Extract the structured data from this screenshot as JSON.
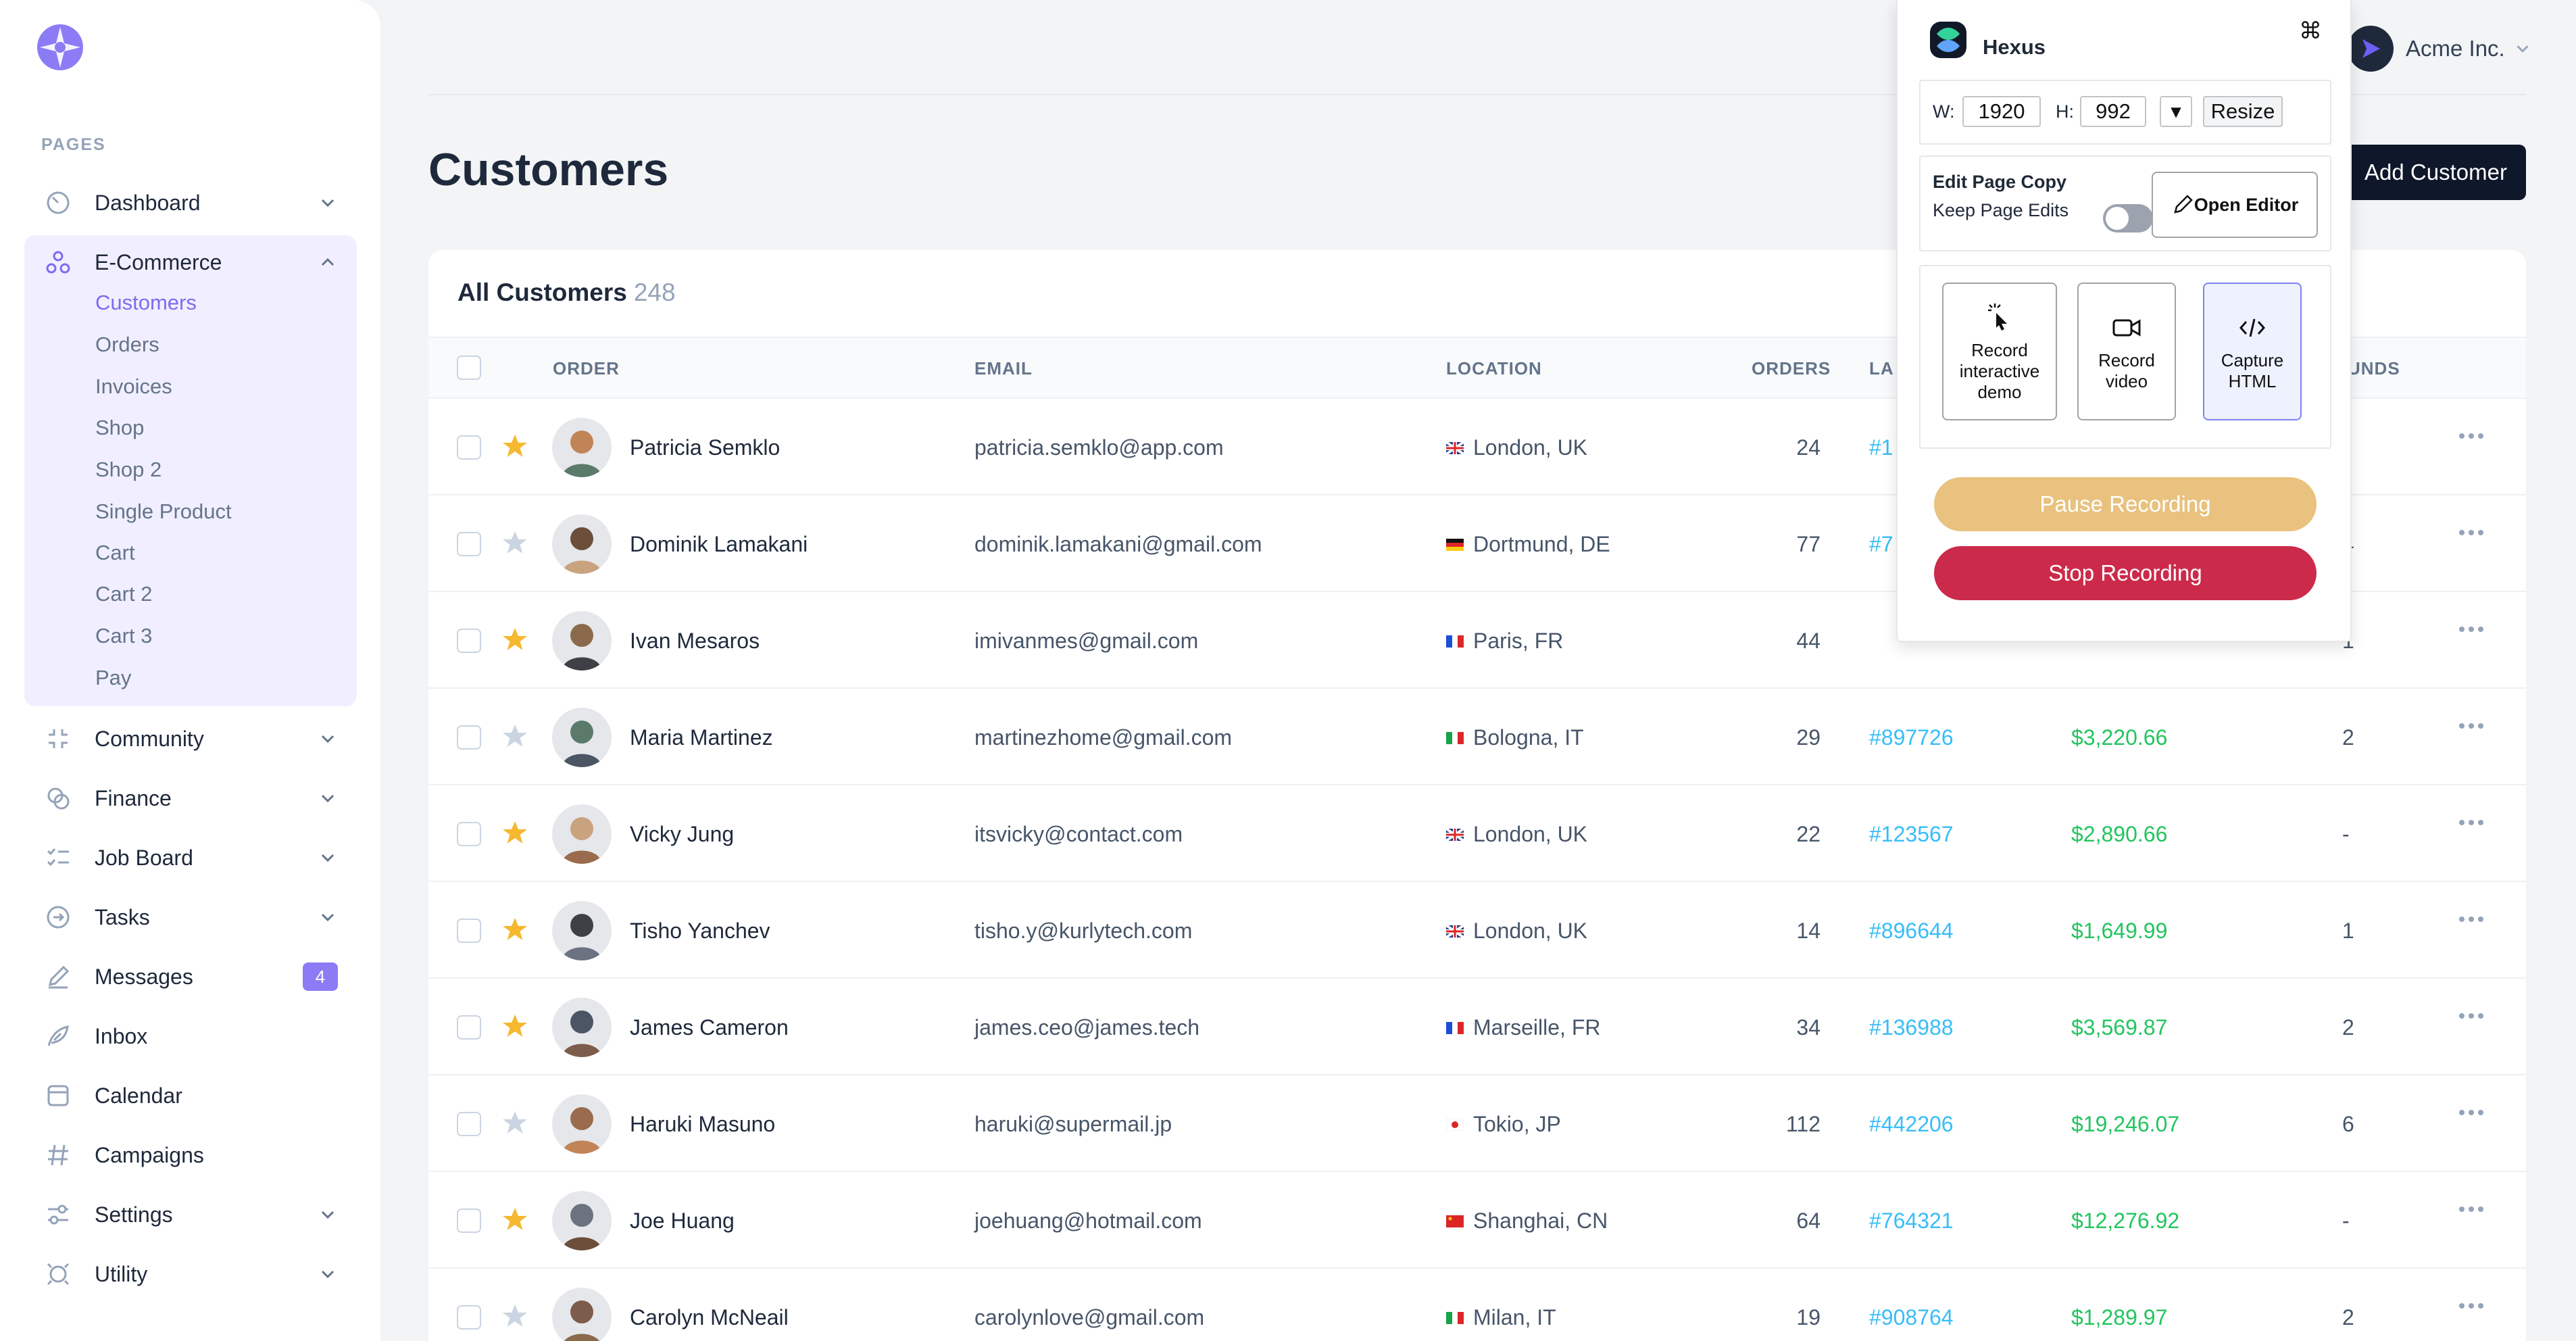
{
  "sidebar": {
    "pages_label": "PAGES",
    "items": [
      {
        "label": "Dashboard"
      },
      {
        "label": "E-Commerce"
      },
      {
        "label": "Community"
      },
      {
        "label": "Finance"
      },
      {
        "label": "Job Board"
      },
      {
        "label": "Tasks"
      },
      {
        "label": "Messages",
        "badge": "4"
      },
      {
        "label": "Inbox"
      },
      {
        "label": "Calendar"
      },
      {
        "label": "Campaigns"
      },
      {
        "label": "Settings"
      },
      {
        "label": "Utility"
      }
    ],
    "ecommerce_sub": [
      "Customers",
      "Orders",
      "Invoices",
      "Shop",
      "Shop 2",
      "Single Product",
      "Cart",
      "Cart 2",
      "Cart 3",
      "Pay"
    ],
    "accent": "#7c6cf0"
  },
  "header": {
    "title": "Customers",
    "account": "Acme Inc.",
    "add_button": "Add Customer"
  },
  "table": {
    "title": "All Customers",
    "count": "248",
    "headers": [
      "ORDER",
      "EMAIL",
      "LOCATION",
      "ORDERS",
      "LA",
      "UNDS"
    ],
    "rows": [
      {
        "name": "Patricia Semklo",
        "email": "patricia.semklo@app.com",
        "location": "London, UK",
        "flag": "uk",
        "orders": "24",
        "last": "#1",
        "spent": "",
        "refunds": "-",
        "starred": true
      },
      {
        "name": "Dominik Lamakani",
        "email": "dominik.lamakani@gmail.com",
        "location": "Dortmund, DE",
        "flag": "de",
        "orders": "77",
        "last": "#7",
        "spent": "",
        "refunds": "4",
        "starred": false
      },
      {
        "name": "Ivan Mesaros",
        "email": "imivanmes@gmail.com",
        "location": "Paris, FR",
        "flag": "fr",
        "orders": "44",
        "last": "",
        "spent": "",
        "refunds": "1",
        "starred": true
      },
      {
        "name": "Maria Martinez",
        "email": "martinezhome@gmail.com",
        "location": "Bologna, IT",
        "flag": "it",
        "orders": "29",
        "last": "#897726",
        "spent": "$3,220.66",
        "refunds": "2",
        "starred": false
      },
      {
        "name": "Vicky Jung",
        "email": "itsvicky@contact.com",
        "location": "London, UK",
        "flag": "uk",
        "orders": "22",
        "last": "#123567",
        "spent": "$2,890.66",
        "refunds": "-",
        "starred": true
      },
      {
        "name": "Tisho Yanchev",
        "email": "tisho.y@kurlytech.com",
        "location": "London, UK",
        "flag": "uk",
        "orders": "14",
        "last": "#896644",
        "spent": "$1,649.99",
        "refunds": "1",
        "starred": true
      },
      {
        "name": "James Cameron",
        "email": "james.ceo@james.tech",
        "location": "Marseille, FR",
        "flag": "fr",
        "orders": "34",
        "last": "#136988",
        "spent": "$3,569.87",
        "refunds": "2",
        "starred": true
      },
      {
        "name": "Haruki Masuno",
        "email": "haruki@supermail.jp",
        "location": "Tokio, JP",
        "flag": "jp",
        "orders": "112",
        "last": "#442206",
        "spent": "$19,246.07",
        "refunds": "6",
        "starred": false
      },
      {
        "name": "Joe Huang",
        "email": "joehuang@hotmail.com",
        "location": "Shanghai, CN",
        "flag": "cn",
        "orders": "64",
        "last": "#764321",
        "spent": "$12,276.92",
        "refunds": "-",
        "starred": true
      },
      {
        "name": "Carolyn McNeail",
        "email": "carolynlove@gmail.com",
        "location": "Milan, IT",
        "flag": "it",
        "orders": "19",
        "last": "#908764",
        "spent": "$1,289.97",
        "refunds": "2",
        "starred": false
      }
    ]
  },
  "hexus": {
    "title": "Hexus",
    "cmd": "⌘",
    "w_label": "W:",
    "w_value": "1920",
    "h_label": "H:",
    "h_value": "992",
    "dropdown": "▾",
    "resize": "Resize",
    "edit_title": "Edit Page Copy",
    "keep_edits": "Keep Page Edits",
    "open_editor": "Open Editor",
    "record_demo": "Record interactive demo",
    "record_video": "Record video",
    "capture_html": "Capture HTML",
    "pause": "Pause Recording",
    "stop": "Stop Recording",
    "pause_color": "#e8c27e",
    "stop_color": "#cc2a4a"
  }
}
